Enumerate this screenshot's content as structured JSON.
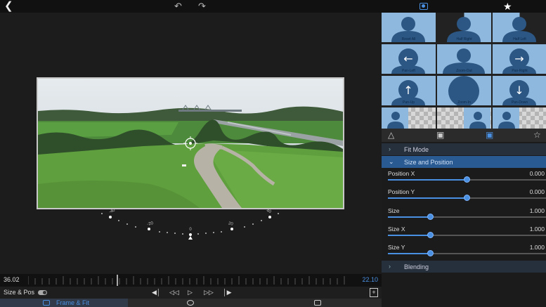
{
  "topbar": {
    "back_icon": "chevron-left-icon",
    "undo_icon": "undo-icon",
    "redo_icon": "redo-icon",
    "frame_icon": "frame-fit-icon",
    "favorites_icon": "star-icon"
  },
  "timeline": {
    "start_time": "36.02",
    "end_time": "22.10"
  },
  "transport": {
    "label": "Size & Pos",
    "toggle_on": true,
    "buttons": [
      "skip-start-icon",
      "step-back-icon",
      "play-icon",
      "step-forward-icon",
      "skip-end-icon"
    ],
    "add_icon": "add-keyframe-icon"
  },
  "bottom_tabs": {
    "active_label": "Frame & Fit",
    "items": [
      "frame-fit-icon",
      "speedometer-icon",
      "export-icon"
    ]
  },
  "presets": [
    {
      "label": "Reset All",
      "kind": "reset"
    },
    {
      "label": "Half Right",
      "kind": "half-right"
    },
    {
      "label": "Half Left",
      "kind": "half-left"
    },
    {
      "label": "Pan-Left",
      "kind": "pan-left"
    },
    {
      "label": "Zoom-Out",
      "kind": "zoom-out"
    },
    {
      "label": "Pan-Right",
      "kind": "pan-right"
    },
    {
      "label": "Pan-Up",
      "kind": "pan-up"
    },
    {
      "label": "Zoom-In",
      "kind": "zoom-in"
    },
    {
      "label": "Pan-Down",
      "kind": "pan-down"
    },
    {
      "label": "",
      "kind": "partial-1"
    },
    {
      "label": "",
      "kind": "partial-2"
    },
    {
      "label": "",
      "kind": "partial-3"
    }
  ],
  "panel_tabs": [
    "warning-icon",
    "crop-icon",
    "frame-fit-icon",
    "star-icon"
  ],
  "sections": {
    "fit_mode": "Fit Mode",
    "size_position": "Size and Position",
    "blending": "Blending"
  },
  "params": [
    {
      "name": "Position X",
      "value": "0.000",
      "level": 0.5
    },
    {
      "name": "Position Y",
      "value": "0.000",
      "level": 0.5
    },
    {
      "name": "Size",
      "value": "1.000",
      "level": 0.27
    },
    {
      "name": "Size X",
      "value": "1.000",
      "level": 0.27
    },
    {
      "name": "Size Y",
      "value": "1.000",
      "level": 0.27
    }
  ],
  "dial": {
    "labels": [
      "-40",
      "-20",
      "0",
      "20",
      "40"
    ]
  },
  "colors": {
    "accent": "#4a90e2",
    "panel_bg": "#1b1b1b",
    "section_open": "#2a5a92"
  }
}
